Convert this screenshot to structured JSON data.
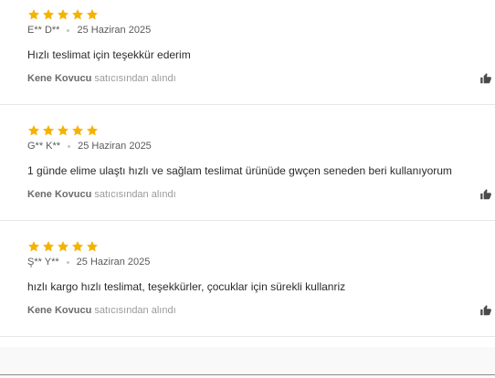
{
  "colors": {
    "star": "#f5b301",
    "text": "#2a2a2a",
    "muted": "#9a9a9a",
    "divider": "#e7e7e7"
  },
  "reviews": [
    {
      "rating": 5,
      "author": "E** D**",
      "date": "25 Haziran 2025",
      "comment": "Hızlı teslimat için teşekkür ederim",
      "seller_name": "Kene Kovucu",
      "seller_suffix": "satıcısından alındı",
      "like_icon": "thumbs-up-icon"
    },
    {
      "rating": 5,
      "author": "G** K**",
      "date": "25 Haziran 2025",
      "comment": "1 günde elime ulaştı hızlı ve sağlam teslimat ürünüde gwçen seneden beri kullanıyorum",
      "seller_name": "Kene Kovucu",
      "seller_suffix": "satıcısından alındı",
      "like_icon": "thumbs-up-icon"
    },
    {
      "rating": 5,
      "author": "Ş** Y**",
      "date": "25 Haziran 2025",
      "comment": "hızlı kargo hızlı teslimat, teşekkürler, çocuklar için sürekli kullanriz",
      "seller_name": "Kene Kovucu",
      "seller_suffix": "satıcısından alındı",
      "like_icon": "thumbs-up-icon"
    }
  ]
}
